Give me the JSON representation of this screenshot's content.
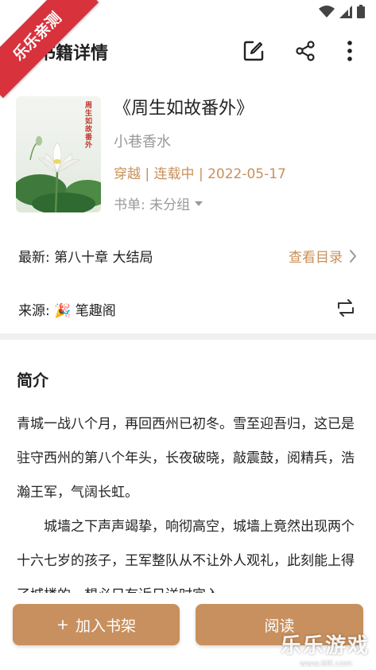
{
  "status_bar": {
    "icons": [
      "wifi-icon",
      "signal-icon",
      "battery-icon"
    ]
  },
  "ribbon": {
    "text": "乐乐亲测"
  },
  "app_bar": {
    "title": "书籍详情",
    "actions": [
      "edit-icon",
      "share-icon",
      "more-icon"
    ]
  },
  "book": {
    "cover_title": "周生如故番外",
    "name": "《周生如故番外》",
    "author": "小巷香水",
    "meta": "穿越 | 连载中 | 2022-05-17",
    "booklist": "书单: 未分组"
  },
  "latest": {
    "label": "最新: 第八十章 大结局",
    "action": "查看目录"
  },
  "source": {
    "label": "来源: 🎉 笔趣阁"
  },
  "intro": {
    "title": "简介",
    "paragraphs": [
      "青城一战八个月，再回西州已初冬。雪至迎吾归，这已是驻守西州的第八个年头，长夜破晓，敲震鼓，阅精兵，浩瀚王军，气阔长虹。",
      "城墙之下声声竭挚，响彻高空，城墙上竟然出现两个十六七岁的孩子，王军整队从不让外人观礼，此刻能上得了城楼的，想必只有近日送时宜入"
    ]
  },
  "buttons": {
    "add": "加入书架",
    "add_icon": "+",
    "read": "阅读"
  },
  "watermark": {
    "text": "乐乐游戏",
    "url": "www.6lll.com"
  },
  "colors": {
    "accent": "#c8905e",
    "ribbon": "#d8323c",
    "divider": "#f0f0f0"
  }
}
